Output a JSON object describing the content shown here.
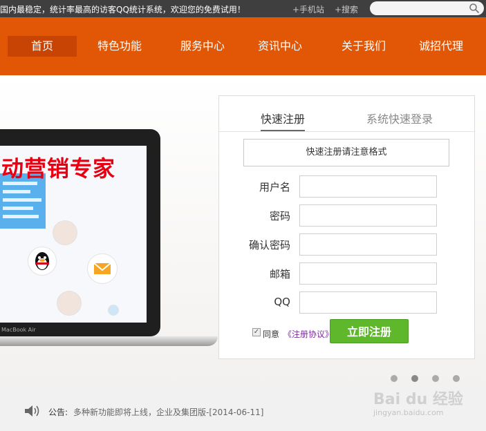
{
  "topbar": {
    "slogan": "国内最稳定，统计率最高的访客QQ统计系统，欢迎您的免费试用！",
    "mobile_link": "+手机站",
    "search_link": "+搜索",
    "search_placeholder": ""
  },
  "nav": {
    "items": [
      {
        "label": "首页"
      },
      {
        "label": "特色功能"
      },
      {
        "label": "服务中心"
      },
      {
        "label": "资讯中心"
      },
      {
        "label": "关于我们"
      },
      {
        "label": "诚招代理"
      }
    ],
    "active_index": 0
  },
  "hero": {
    "promo_text": "动营销专家",
    "laptop_label": "MacBook Air"
  },
  "register_form": {
    "tabs": [
      {
        "label": "快速注册"
      },
      {
        "label": "系统快速登录"
      }
    ],
    "notice": "快速注册请注意格式",
    "fields": [
      {
        "label": "用户名",
        "value": ""
      },
      {
        "label": "密码",
        "value": ""
      },
      {
        "label": "确认密码",
        "value": ""
      },
      {
        "label": "邮箱",
        "value": ""
      },
      {
        "label": "QQ",
        "value": ""
      }
    ],
    "agree_label": "同意",
    "agree_link": "《注册协议》",
    "agree_checked": true,
    "submit_label": "立即注册"
  },
  "carousel": {
    "count": 4,
    "active_index": 1
  },
  "announcement": {
    "label": "公告:",
    "text": "多种新功能即将上线，企业及集团版-[2014-06-11]"
  },
  "watermark": {
    "text": "Bai du 经验",
    "sub": "jingyan.baidu.com"
  },
  "colors": {
    "nav_bg": "#e25705",
    "nav_active": "#c74404",
    "submit_bg": "#5fb82c",
    "promo_red": "#e60012"
  }
}
